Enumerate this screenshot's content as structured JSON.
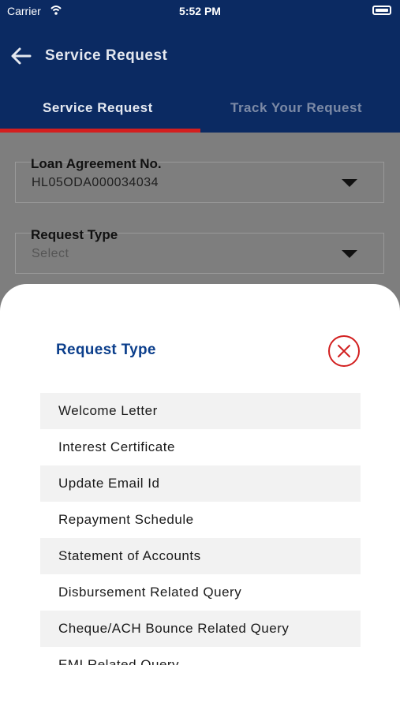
{
  "status_bar": {
    "carrier": "Carrier",
    "time": "5:52 PM"
  },
  "header": {
    "title": "Service Request",
    "tabs": [
      {
        "label": "Service Request",
        "selected": true
      },
      {
        "label": "Track Your Request",
        "selected": false
      }
    ]
  },
  "form": {
    "loan_label": "Loan Agreement No.",
    "loan_value": "HL05ODA000034034",
    "request_type_label": "Request Type",
    "request_type_placeholder": "Select"
  },
  "sheet": {
    "title": "Request Type",
    "items": [
      "Welcome Letter",
      "Interest Certificate",
      "Update Email Id",
      "Repayment Schedule",
      "Statement of Accounts",
      "Disbursement Related Query",
      "Cheque/ACH Bounce Related Query",
      "EMI Related Query"
    ]
  },
  "colors": {
    "header_bg": "#0b2a62",
    "accent_red": "#d21f1f",
    "sheet_title": "#0c3f8c"
  }
}
